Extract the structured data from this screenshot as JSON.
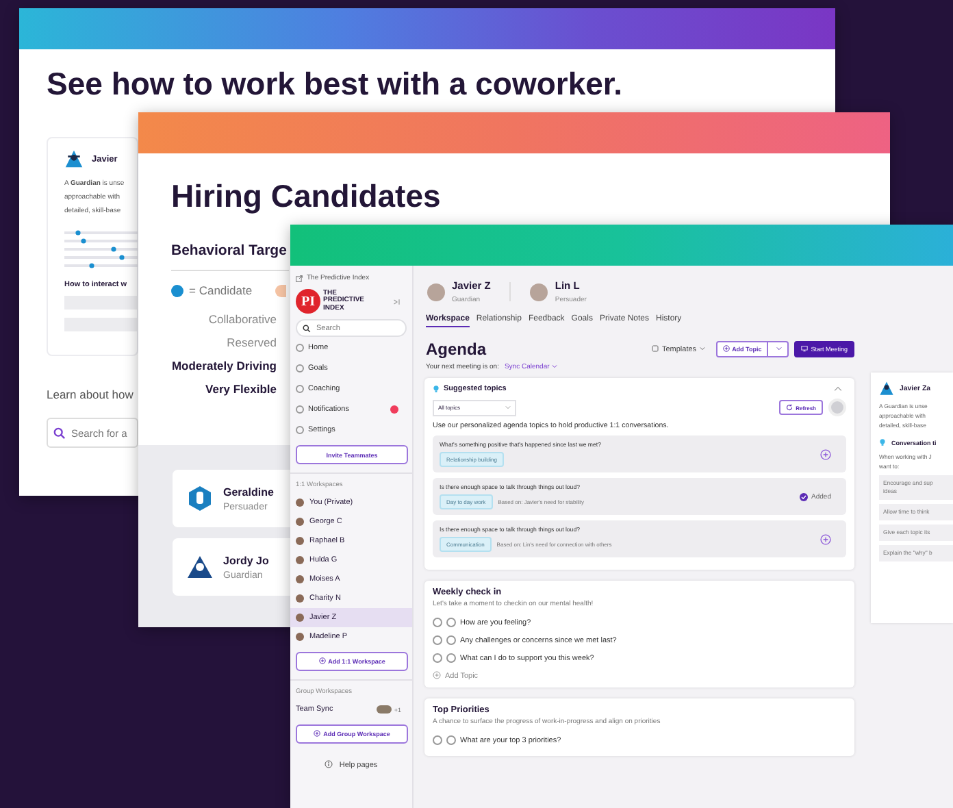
{
  "coworker_page": {
    "title": "See how to work best with a coworker.",
    "profile_card": {
      "name": "Javier ",
      "description_lines": [
        "A **Guardian** is unse",
        "approachable with",
        "detailed, skill-base"
      ],
      "section": "How to interact w"
    },
    "learn_label": "Learn about how",
    "search": {
      "placeholder": "Search for a"
    }
  },
  "hiring_page": {
    "title": "Hiring Candidates",
    "section": "Behavioral Targe",
    "legend": "= Candidate",
    "traits": [
      {
        "label": "Collaborative",
        "emphasized": false
      },
      {
        "label": "Reserved",
        "emphasized": false
      },
      {
        "label": "Moderately Driving",
        "emphasized": true
      },
      {
        "label": "Very Flexible",
        "emphasized": true
      }
    ],
    "people": [
      {
        "name": "Geraldine",
        "role": "Persuader",
        "kind": "persuader"
      },
      {
        "name": "Jordy Jo",
        "role": "Guardian",
        "kind": "guardian"
      }
    ]
  },
  "app": {
    "brand": "The Predictive Index",
    "logo": "PI",
    "logo_caption": "THE PREDICTIVE INDEX",
    "search": {
      "placeholder": "Search"
    },
    "nav": [
      {
        "label": "Home",
        "alert": false
      },
      {
        "label": "Goals",
        "alert": false
      },
      {
        "label": "Coaching",
        "alert": false
      },
      {
        "label": "Notifications",
        "alert": true
      },
      {
        "label": "Settings",
        "alert": false
      }
    ],
    "invite_button": "Invite Teammates",
    "workspaces_heading": "1:1 Workspaces",
    "workspaces": [
      {
        "name": "You (Private)",
        "selected": false
      },
      {
        "name": "George C",
        "selected": false
      },
      {
        "name": "Raphael B",
        "selected": false
      },
      {
        "name": "Hulda G",
        "selected": false
      },
      {
        "name": "Moises A",
        "selected": false
      },
      {
        "name": "Charity N",
        "selected": false
      },
      {
        "name": "Javier Z",
        "selected": true
      },
      {
        "name": "Madeline P",
        "selected": false
      }
    ],
    "add_workspace_button": "Add 1:1 Workspace",
    "group_heading": "Group Workspaces",
    "groups": [
      {
        "name": "Team Sync",
        "extra": "+1"
      }
    ],
    "add_group_button": "Add Group Workspace",
    "help": "Help pages",
    "participants": [
      {
        "name": "Javier Z",
        "role": "Guardian"
      },
      {
        "name": "Lin L",
        "role": "Persuader"
      }
    ],
    "tabs": [
      {
        "label": "Workspace",
        "selected": true
      },
      {
        "label": "Relationship",
        "selected": false
      },
      {
        "label": "Feedback",
        "selected": false
      },
      {
        "label": "Goals",
        "selected": false
      },
      {
        "label": "Private Notes",
        "selected": false
      },
      {
        "label": "History",
        "selected": false
      }
    ],
    "agenda_title": "Agenda",
    "templates": "Templates",
    "add_topic": "Add Topic",
    "start_meeting": "Start Meeting",
    "next_meeting_label": "Your next meeting is on:",
    "sync_link": "Sync Calendar",
    "suggested": {
      "title": "Suggested topics",
      "filter": "All topics",
      "refresh": "Refresh",
      "intro": "Use our personalized agenda topics to hold productive 1:1 conversations.",
      "added_label": "Added",
      "topics": [
        {
          "question": "What's something positive that's happened since last we met?",
          "tag": "Relationship building",
          "added": false
        },
        {
          "question": "Is there enough space to talk through things out loud?",
          "tag": "Day to day work",
          "basis": "Based on: Javier's need for stability",
          "added": true
        },
        {
          "question": "Is there enough space to talk through things out loud?",
          "tag": "Communication",
          "basis": "Based on: Lin's need for connection with others",
          "added": false
        }
      ]
    },
    "sections": [
      {
        "title": "Weekly check in",
        "subtitle": "Let's take a moment to checkin on our mental health!",
        "items": [
          "How are you feeling?",
          "Any challenges or concerns since we met last?",
          "What can I do to support you this week?"
        ],
        "add_label": "Add Topic"
      },
      {
        "title": "Top Priorities",
        "subtitle": "A chance to surface the progress of work-in-progress and align on priorities",
        "items": [
          "What are your top 3 priorities?"
        ]
      }
    ],
    "right_panel": {
      "name": "Javier Za",
      "lines": [
        "A Guardian is unse",
        "approachable with",
        "detailed, skill-base"
      ],
      "tips_title": "Conversation ti",
      "tips_intro": [
        "When working with J",
        "want to:"
      ],
      "tips": [
        [
          "Encourage and sup",
          "ideas"
        ],
        [
          "Allow time to think"
        ],
        [
          "Give each topic its"
        ],
        [
          "Explain the \"why\" b"
        ]
      ]
    }
  }
}
